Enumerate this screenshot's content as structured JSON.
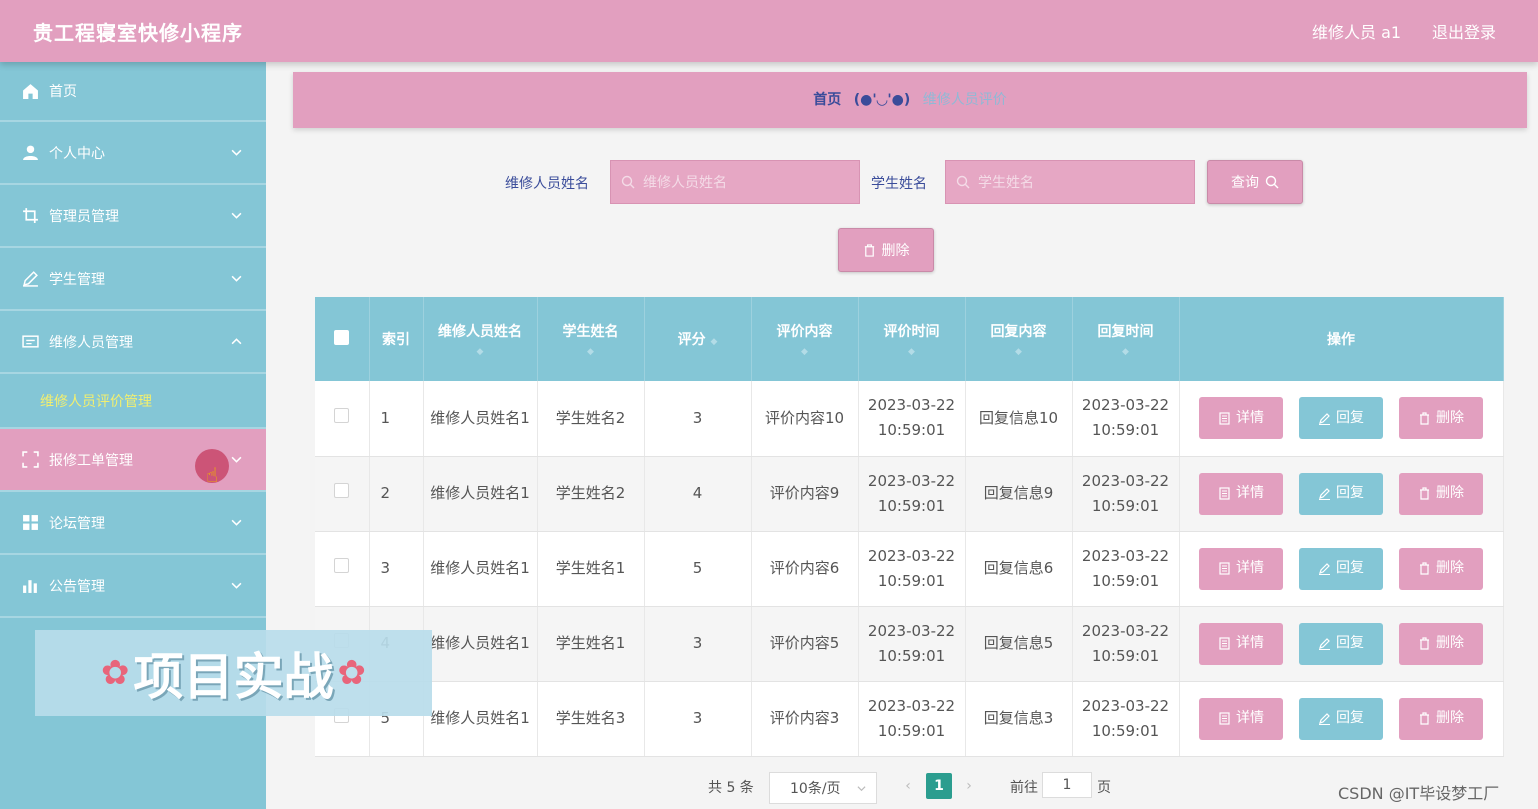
{
  "header": {
    "title": "贵工程寝室快修小程序",
    "user": "维修人员 a1",
    "logout": "退出登录"
  },
  "sidebar": {
    "items": [
      {
        "label": "首页",
        "icon": "home-icon"
      },
      {
        "label": "个人中心",
        "icon": "user-icon"
      },
      {
        "label": "管理员管理",
        "icon": "crop-icon"
      },
      {
        "label": "学生管理",
        "icon": "edit-icon"
      },
      {
        "label": "维修人员管理",
        "icon": "card-icon"
      },
      {
        "label": "报修工单管理",
        "icon": "fullscreen-icon"
      },
      {
        "label": "论坛管理",
        "icon": "grid-icon"
      },
      {
        "label": "公告管理",
        "icon": "bar-chart-icon"
      }
    ],
    "submenu": {
      "label": "维修人员评价管理"
    }
  },
  "overlay": {
    "text": "项目实战"
  },
  "breadcrumb": {
    "home": "首页",
    "face": "(●'◡'●)",
    "current": "维修人员评价"
  },
  "search": {
    "worker_label": "维修人员姓名",
    "worker_placeholder": "维修人员姓名",
    "student_label": "学生姓名",
    "student_placeholder": "学生姓名",
    "query_button": "查询"
  },
  "bulk_delete": "删除",
  "table": {
    "headers": [
      "索引",
      "维修人员姓名",
      "学生姓名",
      "评分",
      "评价内容",
      "评价时间",
      "回复内容",
      "回复时间",
      "操作"
    ],
    "rows": [
      {
        "index": "1",
        "worker": "维修人员姓名1",
        "student": "学生姓名2",
        "score": "3",
        "content": "评价内容10",
        "eval_date": "2023-03-22",
        "eval_time": "10:59:01",
        "reply": "回复信息10",
        "reply_date": "2023-03-22",
        "reply_time": "10:59:01"
      },
      {
        "index": "2",
        "worker": "维修人员姓名1",
        "student": "学生姓名2",
        "score": "4",
        "content": "评价内容9",
        "eval_date": "2023-03-22",
        "eval_time": "10:59:01",
        "reply": "回复信息9",
        "reply_date": "2023-03-22",
        "reply_time": "10:59:01"
      },
      {
        "index": "3",
        "worker": "维修人员姓名1",
        "student": "学生姓名1",
        "score": "5",
        "content": "评价内容6",
        "eval_date": "2023-03-22",
        "eval_time": "10:59:01",
        "reply": "回复信息6",
        "reply_date": "2023-03-22",
        "reply_time": "10:59:01"
      },
      {
        "index": "4",
        "worker": "维修人员姓名1",
        "student": "学生姓名1",
        "score": "3",
        "content": "评价内容5",
        "eval_date": "2023-03-22",
        "eval_time": "10:59:01",
        "reply": "回复信息5",
        "reply_date": "2023-03-22",
        "reply_time": "10:59:01"
      },
      {
        "index": "5",
        "worker": "维修人员姓名1",
        "student": "学生姓名3",
        "score": "3",
        "content": "评价内容3",
        "eval_date": "2023-03-22",
        "eval_time": "10:59:01",
        "reply": "回复信息3",
        "reply_date": "2023-03-22",
        "reply_time": "10:59:01"
      }
    ],
    "ops": {
      "detail": "详情",
      "reply": "回复",
      "delete": "删除"
    }
  },
  "pagination": {
    "total": "共 5 条",
    "page_size": "10条/页",
    "current_page": "1",
    "goto_prefix": "前往",
    "goto_value": "1",
    "goto_suffix": "页"
  },
  "watermark": "CSDN @IT毕设梦工厂",
  "colors": {
    "pink": "#e29fbf",
    "teal": "#84c6d6",
    "pager_active": "#2b9d8f",
    "submenu_active": "#f2ef6f"
  }
}
